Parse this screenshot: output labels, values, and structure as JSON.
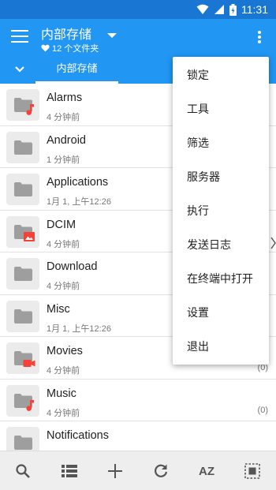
{
  "status_bar": {
    "time": "11:31"
  },
  "app_bar": {
    "title": "内部存储",
    "subtitle": "12 个文件夹"
  },
  "tabs": [
    {
      "label": "内部存储"
    }
  ],
  "files": [
    {
      "name": "Alarms",
      "date": "4 分钟前",
      "count": "",
      "badge": "music-note-icon"
    },
    {
      "name": "Android",
      "date": "1 分钟前",
      "count": "",
      "badge": ""
    },
    {
      "name": "Applications",
      "date": "1月 1, 上午12:26",
      "count": "",
      "badge": ""
    },
    {
      "name": "DCIM",
      "date": "4 分钟前",
      "count": "",
      "badge": "image-icon"
    },
    {
      "name": "Download",
      "date": "4 分钟前",
      "count": "",
      "badge": ""
    },
    {
      "name": "Misc",
      "date": "1月 1, 上午12:26",
      "count": "",
      "badge": ""
    },
    {
      "name": "Movies",
      "date": "4 分钟前",
      "count": "(0)",
      "badge": "video-icon"
    },
    {
      "name": "Music",
      "date": "4 分钟前",
      "count": "(0)",
      "badge": "music-note-icon"
    },
    {
      "name": "Notifications",
      "date": "",
      "count": "",
      "badge": ""
    }
  ],
  "menu": {
    "items": [
      "锁定",
      "工具",
      "筛选",
      "服务器",
      "执行",
      "发送日志",
      "在终端中打开",
      "设置",
      "退出"
    ]
  },
  "bottom_bar": {
    "sort_label": "AZ"
  },
  "colors": {
    "primary": "#2196f3",
    "status_bar": "#1976d2",
    "badge_red": "#f44336"
  }
}
